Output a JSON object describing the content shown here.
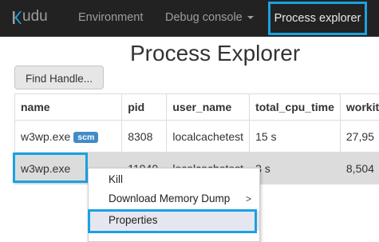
{
  "navbar": {
    "brand": "udu",
    "items": {
      "environment": "Environment",
      "debug_console": "Debug console",
      "process_explorer": "Process explorer"
    }
  },
  "page": {
    "title": "Process Explorer",
    "find_handle_label": "Find Handle..."
  },
  "table": {
    "headers": [
      "name",
      "pid",
      "user_name",
      "total_cpu_time",
      "workit"
    ],
    "rows": [
      {
        "name": "w3wp.exe",
        "badge": "scm",
        "pid": "8308",
        "user_name": "localcachetest",
        "total_cpu_time": "15 s",
        "workit": "27,95"
      },
      {
        "name": "w3wp.exe",
        "badge": "",
        "pid": "11940",
        "user_name": "localcachetest",
        "total_cpu_time": "3 s",
        "workit": "8,504"
      }
    ]
  },
  "context_menu": {
    "kill": "Kill",
    "download_dump": "Download Memory Dump",
    "submenu_arrow": ">",
    "properties": "Properties"
  },
  "colors": {
    "navbar_bg": "#222222",
    "highlight_border": "#1ba1e2",
    "badge_bg": "#428bca"
  }
}
